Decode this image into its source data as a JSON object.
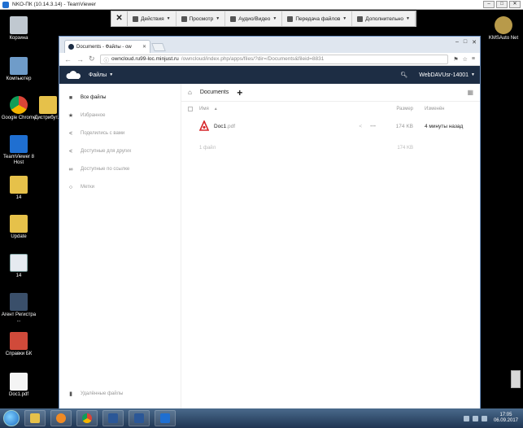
{
  "teamviewer": {
    "title": "NKO-ПК (10.14.3.14) - TeamViewer",
    "toolbar": [
      "Действия",
      "Просмотр",
      "Аудио/Видео",
      "Передача файлов",
      "Дополнительно"
    ]
  },
  "desktop_icons": [
    {
      "label": "Корзина",
      "color": "#c0c8d0"
    },
    {
      "label": "Компьютер",
      "color": "#6f9cc9"
    },
    {
      "label": "Google Chrome",
      "color": "#e0b83a"
    },
    {
      "label": "Дистрибут...",
      "color": "#e6c14a"
    },
    {
      "label": "TeamViewer 8 Host",
      "color": "#1f6fd1"
    },
    {
      "label": "14",
      "color": "#e6c14a"
    },
    {
      "label": "Update",
      "color": "#e6c14a"
    },
    {
      "label": "14",
      "color": "#e5eaf0"
    },
    {
      "label": "Агент Регистра ...",
      "color": "#3a4f6a"
    },
    {
      "label": "Справки БК",
      "color": "#d04a3a"
    },
    {
      "label": "Doc1.pdf",
      "color": "#f4f4f4"
    },
    {
      "label": "KMSAuto Net",
      "color": "#b89a4a"
    }
  ],
  "browser": {
    "tab_title": "Documents - Файлы - ow",
    "url_host": "owncloud.ru99-loc.minjust.ru",
    "url_path": "/owncloud/index.php/apps/files/?dir=/Documents&fileid=8831"
  },
  "owncloud": {
    "app_name": "Файлы",
    "user_name": "WebDAVUsr-14001",
    "sidebar": [
      "Все файлы",
      "Избранное",
      "Поделились с вами",
      "Доступные для других",
      "Доступные по ссылке",
      "Метки"
    ],
    "sidebar_bottom": "Удалённые файлы",
    "breadcrumb": "Documents",
    "columns": {
      "name": "Имя",
      "size": "Размер",
      "modified": "Изменён"
    },
    "file": {
      "base": "Doc1",
      "ext": ".pdf",
      "size": "174 KB",
      "modified": "4 минуты назад"
    },
    "summary": {
      "count": "1 файл",
      "size": "174 KB"
    }
  },
  "taskbar": {
    "time": "17:05",
    "date": "06.09.2017"
  }
}
